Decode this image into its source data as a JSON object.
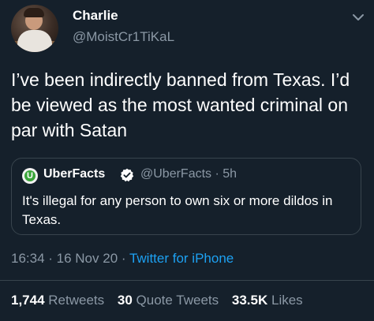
{
  "author": {
    "name": "Charlie",
    "handle": "@MoistCr1TiKaL"
  },
  "tweet": {
    "text": "I’ve been indirectly banned from Texas. I’d be viewed as the most wanted criminal on par with Satan"
  },
  "quoted": {
    "logo_letter": "U",
    "name": "UberFacts",
    "handle_time": "@UberFacts · 5h",
    "text": "It's illegal for any person to own six or more dildos in Texas."
  },
  "meta": {
    "time_date": "16:34 · 16 Nov 20 · ",
    "source": "Twitter for iPhone"
  },
  "stats": {
    "retweets_count": "1,744",
    "retweets_label": "Retweets",
    "quotes_count": "30",
    "quotes_label": "Quote Tweets",
    "likes_count": "33.5K",
    "likes_label": "Likes"
  },
  "icons": {
    "caret": "chevron-down-icon",
    "verified": "verified-badge-icon"
  },
  "colors": {
    "background": "#15202b",
    "secondary_text": "#8b98a5",
    "link": "#1da1f2",
    "border": "#38444d"
  }
}
